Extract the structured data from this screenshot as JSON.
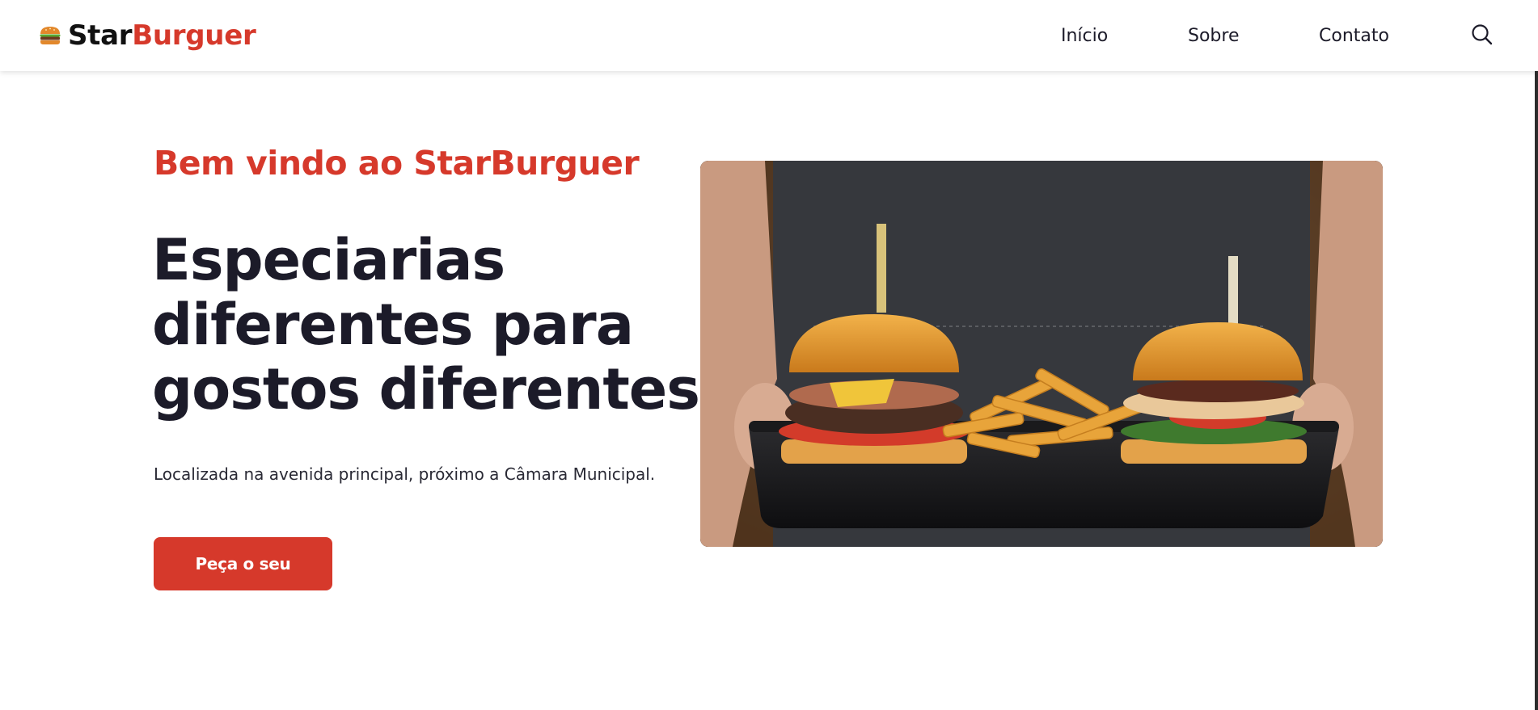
{
  "brand": {
    "name_part1": "Star",
    "name_part2": "Burguer",
    "logo_icon": "burger-icon",
    "colors": {
      "accent": "#d6392b",
      "dark": "#1c1b29"
    }
  },
  "nav": {
    "items": [
      {
        "label": "Início"
      },
      {
        "label": "Sobre"
      },
      {
        "label": "Contato"
      }
    ],
    "search_icon": "search-icon"
  },
  "hero": {
    "subtitle": "Bem vindo ao StarBurguer",
    "title_lines": [
      "Especiarias",
      "diferentes para",
      "gostos diferentes"
    ],
    "description": "Localizada na avenida principal, próximo a Câmara Municipal.",
    "cta_label": "Peça o seu",
    "image_icon": "burgers-tray-photo"
  }
}
